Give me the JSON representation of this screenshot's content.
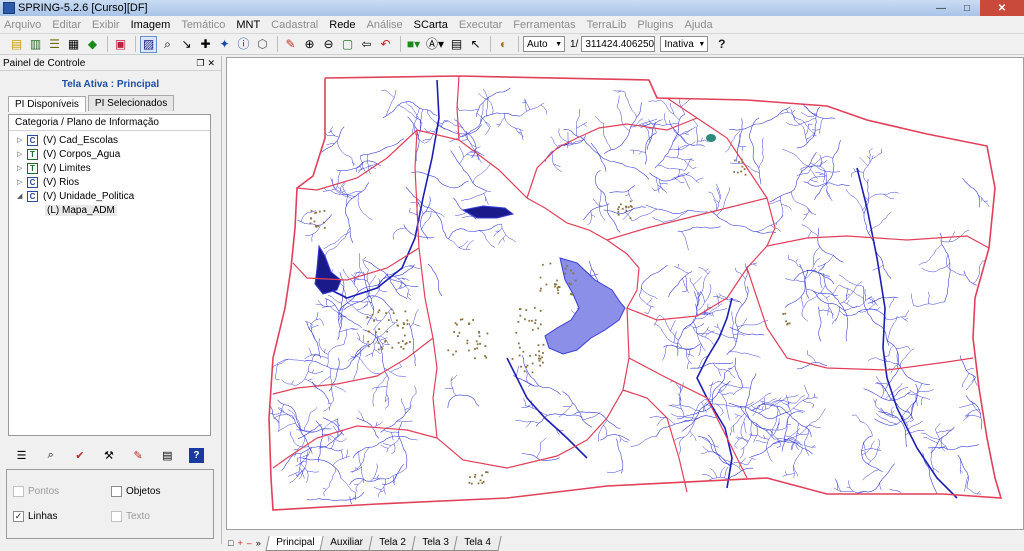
{
  "window": {
    "title": "SPRING-5.2.6 [Curso][DF]"
  },
  "menu": [
    {
      "label": "Arquivo",
      "enabled": false
    },
    {
      "label": "Editar",
      "enabled": false
    },
    {
      "label": "Exibir",
      "enabled": false
    },
    {
      "label": "Imagem",
      "enabled": true
    },
    {
      "label": "Temático",
      "enabled": false
    },
    {
      "label": "MNT",
      "enabled": true
    },
    {
      "label": "Cadastral",
      "enabled": false
    },
    {
      "label": "Rede",
      "enabled": true
    },
    {
      "label": "Análise",
      "enabled": false
    },
    {
      "label": "SCarta",
      "enabled": true
    },
    {
      "label": "Executar",
      "enabled": false
    },
    {
      "label": "Ferramentas",
      "enabled": false
    },
    {
      "label": "TerraLib",
      "enabled": false
    },
    {
      "label": "Plugins",
      "enabled": false
    },
    {
      "label": "Ajuda",
      "enabled": false
    }
  ],
  "toolbar": {
    "scale_mode": "Auto",
    "scale_prefix": "1/",
    "scale_value": "311424.406250",
    "mode_value": "Inativa",
    "icons": [
      "database-icon",
      "open-icon",
      "layers-icon",
      "grid-icon",
      "eraser-icon",
      "screen-icon",
      "display-icon",
      "info-icon",
      "zoom-icon",
      "cursor-icon",
      "pan-icon",
      "info-circle-icon",
      "layers-select-icon",
      "draw-icon",
      "zoom-in-icon",
      "zoom-out-icon",
      "zoom-area-icon",
      "back-icon",
      "undo-icon",
      "color-icon",
      "label-icon",
      "legend-icon",
      "pointer-icon",
      "palette-icon",
      "help-icon"
    ]
  },
  "panel": {
    "title": "Painel de Controle",
    "active_screen": "Tela Ativa : Principal",
    "tabs": [
      "PI Disponíveis",
      "PI Selecionados"
    ],
    "tree_header": "Categoria / Plano de Informação",
    "items": [
      {
        "type": "C",
        "label": "(V) Cad_Escolas"
      },
      {
        "type": "T",
        "label": "(V) Corpos_Agua"
      },
      {
        "type": "T",
        "label": "(V) Limites"
      },
      {
        "type": "C",
        "label": "(V) Rios"
      },
      {
        "type": "C",
        "label": "(V) Unidade_Politica"
      }
    ],
    "sub_item": "(L) Mapa_ADM",
    "options": {
      "pontos": {
        "label": "Pontos",
        "checked": false,
        "enabled": false
      },
      "objetos": {
        "label": "Objetos",
        "checked": false,
        "enabled": true
      },
      "linhas": {
        "label": "Linhas",
        "checked": true,
        "enabled": true
      },
      "texto": {
        "label": "Texto",
        "checked": false,
        "enabled": false
      }
    }
  },
  "screens": [
    {
      "label": "Principal",
      "selected": true
    },
    {
      "label": "Auxiliar",
      "selected": false
    },
    {
      "label": "Tela 2",
      "selected": false
    },
    {
      "label": "Tela 3",
      "selected": false
    },
    {
      "label": "Tela 4",
      "selected": false
    }
  ],
  "colors": {
    "boundary": "#e0405a",
    "rivers": "#3a3fd6",
    "water": "#8b8fe8",
    "schools": "#8a7240"
  }
}
